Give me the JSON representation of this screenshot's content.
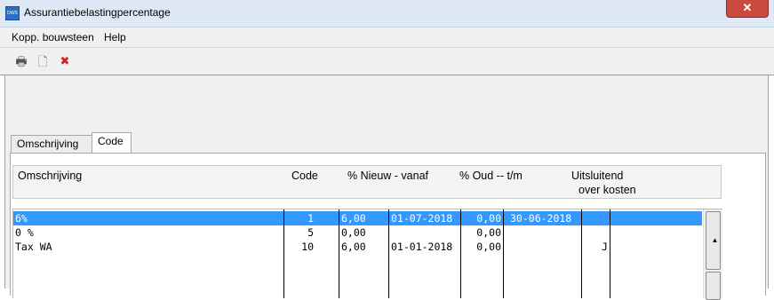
{
  "window": {
    "title": "Assurantiebelastingpercentage",
    "close_glyph": "✕",
    "app_icon_text": "DWS"
  },
  "menu": {
    "items": [
      {
        "label": "Kopp. bouwsteen"
      },
      {
        "label": "Help"
      }
    ]
  },
  "toolbar": {
    "buttons": [
      {
        "icon": "printer-icon",
        "glyph": "🖶"
      },
      {
        "icon": "new-document-icon",
        "glyph": "🗋"
      },
      {
        "icon": "delete-icon",
        "glyph": "✖",
        "color": "#d21f1f"
      }
    ]
  },
  "tabs": [
    {
      "label": "Omschrijving",
      "active": false
    },
    {
      "label": "Code",
      "active": true
    }
  ],
  "table": {
    "headers": {
      "omschrijving": "Omschrijving",
      "code": "Code",
      "nieuw_vanaf": "% Nieuw - vanaf",
      "oud_tm": "% Oud -- t/m",
      "uitsluitend_1": "Uitsluitend",
      "uitsluitend_2": "over kosten"
    },
    "rows": [
      {
        "omschrijving": "6%",
        "code": "1",
        "nieuw": "6,00",
        "vanaf": "01-07-2018",
        "oud": "0,00",
        "tm": "30-06-2018",
        "uitsluitend": "",
        "selected": true
      },
      {
        "omschrijving": "0 %",
        "code": "5",
        "nieuw": "0,00",
        "vanaf": "",
        "oud": "0,00",
        "tm": "",
        "uitsluitend": "",
        "selected": false
      },
      {
        "omschrijving": "Tax WA",
        "code": "10",
        "nieuw": "6,00",
        "vanaf": "01-01-2018",
        "oud": "0,00",
        "tm": "",
        "uitsluitend": "J",
        "selected": false
      }
    ]
  },
  "colors": {
    "selection": "#3399ff",
    "close_button": "#c94a3e",
    "delete_icon": "#d21f1f"
  }
}
